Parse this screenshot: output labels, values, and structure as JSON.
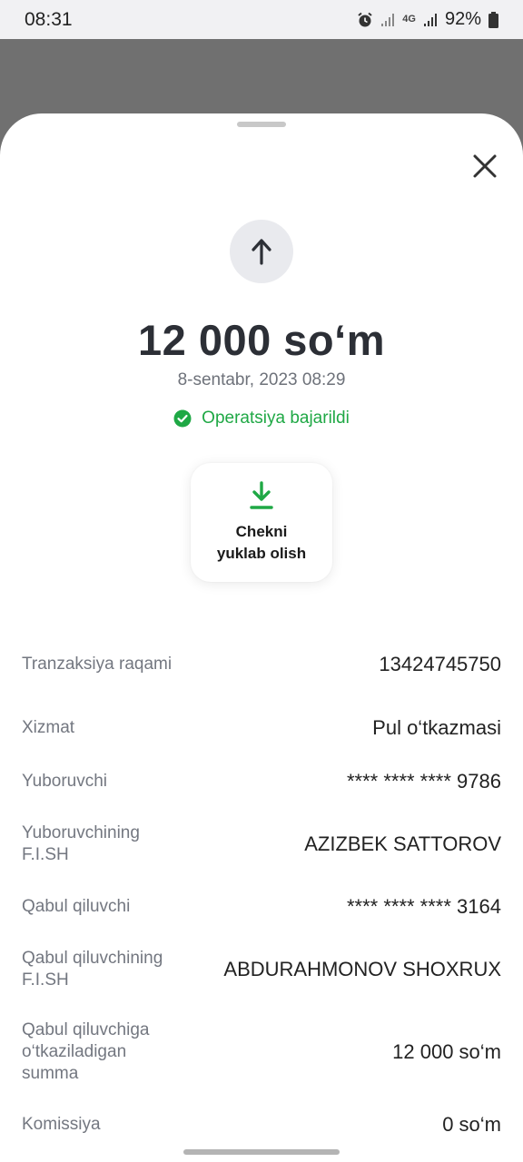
{
  "status_bar": {
    "time": "08:31",
    "network": "4G",
    "battery": "92%",
    "icons": [
      "alarm-icon",
      "signal-icon",
      "4g-icon",
      "signal-icon",
      "battery-icon"
    ]
  },
  "sheet": {
    "close_icon": "close-icon",
    "transaction_icon": "arrow-up-icon",
    "amount": "12 000 so‘m",
    "date": "8-sentabr, 2023 08:29",
    "status_text": "Operatsiya bajarildi",
    "status_icon": "check-circle-icon",
    "download": {
      "label_line1": "Chekni",
      "label_line2": "yuklab olish",
      "icon": "download-icon"
    }
  },
  "details": [
    {
      "label": "Tranzaksiya raqami",
      "value": "13424745750"
    },
    {
      "label": "Xizmat",
      "value": "Pul o‘tkazmasi"
    },
    {
      "label": "Yuboruvchi",
      "value": "**** **** **** 9786"
    },
    {
      "label": "Yuboruvchining F.I.SH",
      "value": "AZIZBEK SATTOROV"
    },
    {
      "label": "Qabul qiluvchi",
      "value": "**** **** **** 3164"
    },
    {
      "label": "Qabul qiluvchining F.I.SH",
      "value": "ABDURAHMONOV SHOXRUX"
    },
    {
      "label": "Qabul qiluvchiga o‘tkaziladigan summa",
      "value": "12 000 so‘m"
    },
    {
      "label": "Komissiya",
      "value": "0 so‘m"
    }
  ],
  "colors": {
    "success": "#1fa845",
    "amount_text": "#2c2f36",
    "overlay": "#707070"
  }
}
